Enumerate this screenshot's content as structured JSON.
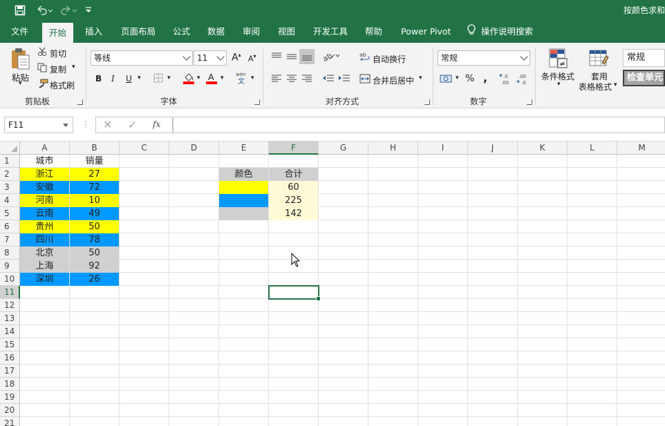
{
  "titlebar": {
    "title": "按颜色求和"
  },
  "tabs": [
    "文件",
    "开始",
    "插入",
    "页面布局",
    "公式",
    "数据",
    "审阅",
    "视图",
    "开发工具",
    "帮助",
    "Power Pivot",
    "操作说明搜索"
  ],
  "ribbon": {
    "clipboard": {
      "paste": "粘贴",
      "cut": "剪切",
      "copy": "复制",
      "painter": "格式刷",
      "title": "剪贴板"
    },
    "font": {
      "name": "等线",
      "size": "11",
      "grow": "A",
      "shrink": "A",
      "bold": "B",
      "italic": "I",
      "underline": "U",
      "title": "字体"
    },
    "align": {
      "wrap": "自动换行",
      "merge": "合并后居中",
      "title": "对齐方式"
    },
    "number": {
      "format": "常规",
      "percent": "%",
      "comma": ",",
      "title": "数字"
    },
    "styles": {
      "cond": "条件格式",
      "table_line1": "套用",
      "table_line2": "表格格式",
      "style_normal": "常规",
      "style_check": "检查单元"
    }
  },
  "formula": {
    "namebox": "F11",
    "fx": "fx",
    "value": ""
  },
  "grid": {
    "columns": [
      "A",
      "B",
      "C",
      "D",
      "E",
      "F",
      "G",
      "H",
      "I",
      "J",
      "K",
      "L",
      "M"
    ],
    "selected_column": "F",
    "rows": [
      "1",
      "2",
      "3",
      "4",
      "5",
      "6",
      "7",
      "8",
      "9",
      "10",
      "11",
      "12",
      "13",
      "14",
      "15",
      "16",
      "17",
      "18",
      "19",
      "20",
      "21"
    ],
    "selected_row": "11",
    "headers": {
      "a1": "城市",
      "b1": "销量"
    },
    "data": [
      {
        "city": "浙江",
        "sales": "27",
        "color": "#ffff00"
      },
      {
        "city": "安徽",
        "sales": "72",
        "color": "#0099ff"
      },
      {
        "city": "河南",
        "sales": "10",
        "color": "#ffff00"
      },
      {
        "city": "云南",
        "sales": "49",
        "color": "#0099ff"
      },
      {
        "city": "贵州",
        "sales": "50",
        "color": "#ffff00"
      },
      {
        "city": "四川",
        "sales": "78",
        "color": "#0099ff"
      },
      {
        "city": "北京",
        "sales": "50",
        "color": "#d0d0d0"
      },
      {
        "city": "上海",
        "sales": "92",
        "color": "#d0d0d0"
      },
      {
        "city": "深圳",
        "sales": "26",
        "color": "#0099ff"
      }
    ],
    "summary": {
      "header_color": "颜色",
      "header_total": "合计",
      "header_bg": "#d0d0d0",
      "total_bg": "#fffbd6",
      "rows": [
        {
          "color": "#ffff00",
          "total": "60"
        },
        {
          "color": "#0099ff",
          "total": "225"
        },
        {
          "color": "#d0d0d0",
          "total": "142"
        }
      ]
    }
  }
}
